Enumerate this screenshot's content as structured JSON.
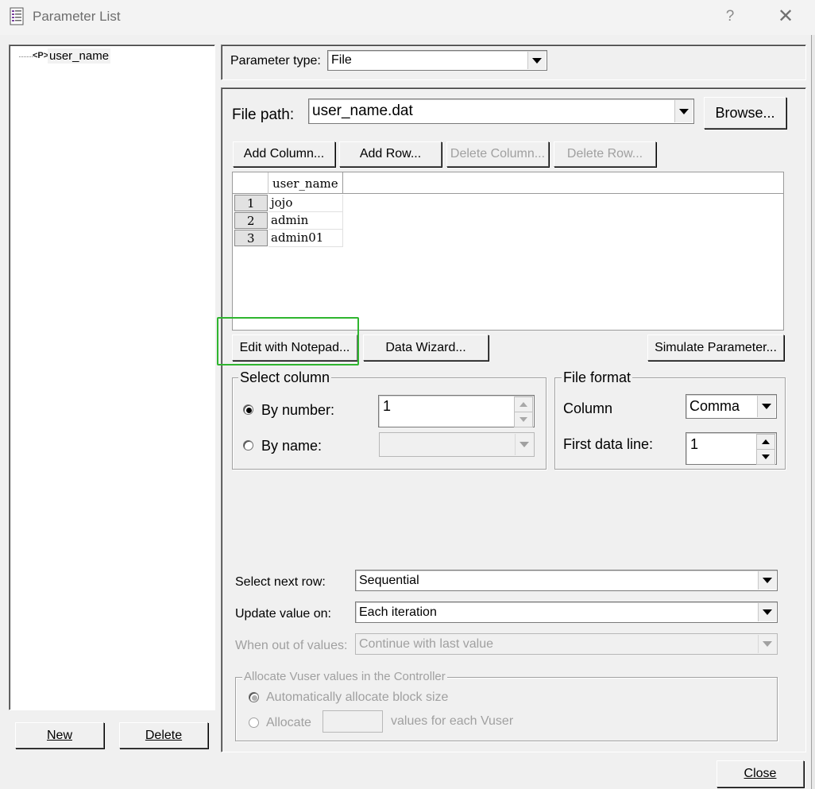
{
  "window": {
    "title": "Parameter List",
    "help": "?",
    "close": "✕"
  },
  "tree": {
    "items": [
      {
        "label": "user_name",
        "icon": "parameter-icon",
        "icon_glyph": "<P>"
      }
    ]
  },
  "left_buttons": {
    "new": "New",
    "delete": "Delete"
  },
  "parameter_type": {
    "label": "Parameter type:",
    "value": "File"
  },
  "file_path": {
    "label": "File path:",
    "value": "user_name.dat",
    "browse": "Browse..."
  },
  "grid_buttons": {
    "add_column": "Add Column...",
    "add_row": "Add Row...",
    "delete_column": "Delete Column...",
    "delete_row": "Delete Row..."
  },
  "grid": {
    "columns": [
      "user_name"
    ],
    "rows": [
      {
        "num": "1",
        "value": "jojo"
      },
      {
        "num": "2",
        "value": "admin"
      },
      {
        "num": "3",
        "value": "admin01"
      }
    ]
  },
  "tool_buttons": {
    "edit_notepad": "Edit with Notepad...",
    "data_wizard": "Data Wizard...",
    "simulate": "Simulate Parameter..."
  },
  "select_column": {
    "title": "Select column",
    "by_number": "By number:",
    "by_number_value": "1",
    "by_name": "By name:",
    "by_name_value": "",
    "selected": "by_number"
  },
  "file_format": {
    "title": "File format",
    "column_label": "Column",
    "column_value": "Comma",
    "first_line_label": "First data line:",
    "first_line_value": "1"
  },
  "row_settings": {
    "select_next_row_label": "Select next row:",
    "select_next_row_value": "Sequential",
    "update_value_label": "Update value on:",
    "update_value_value": "Each iteration",
    "out_of_values_label": "When out of values:",
    "out_of_values_value": "Continue with last value"
  },
  "allocate": {
    "title": "Allocate Vuser values in the Controller",
    "auto": "Automatically allocate block size",
    "allocate": "Allocate",
    "allocate_value": "",
    "suffix": "values for each Vuser"
  },
  "close_button": "Close",
  "colors": {
    "highlight": "#2fb52f",
    "face": "#f0f0f0",
    "disabled_text": "#a0a0a0"
  }
}
